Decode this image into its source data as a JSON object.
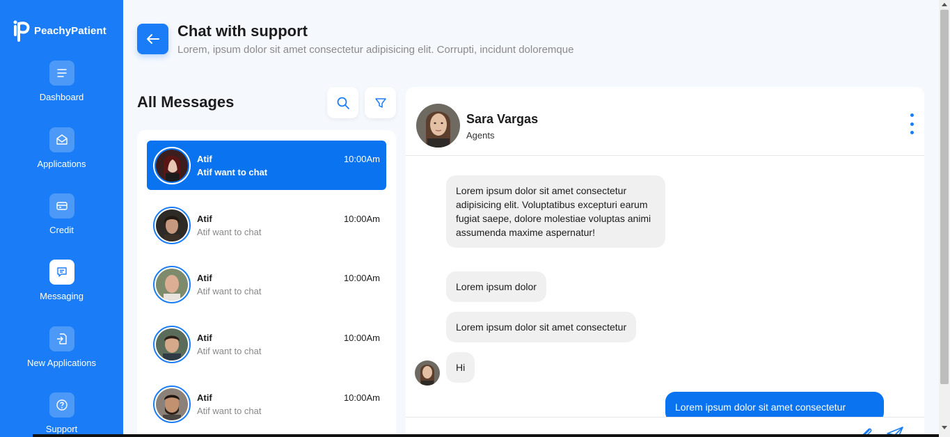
{
  "app": {
    "brand": "PeachyPatient"
  },
  "sidebar": {
    "items": [
      {
        "label": "Dashboard",
        "icon": "menu-icon",
        "active": false
      },
      {
        "label": "Applications",
        "icon": "envelope-icon",
        "active": false
      },
      {
        "label": "Credit",
        "icon": "card-icon",
        "active": false
      },
      {
        "label": "Messaging",
        "icon": "chat-icon",
        "active": true
      },
      {
        "label": "New Applications",
        "icon": "file-import-icon",
        "active": false
      },
      {
        "label": "Support",
        "icon": "help-icon",
        "active": false
      }
    ]
  },
  "header": {
    "title": "Chat with support",
    "subtitle": "Lorem, ipsum dolor sit amet consectetur adipisicing elit. Corrupti, incidunt doloremque"
  },
  "list": {
    "title": "All Messages",
    "conversations": [
      {
        "name": "Atif",
        "message": "Atif want to chat",
        "time": "10:00Am",
        "active": true
      },
      {
        "name": "Atif",
        "message": "Atif want to chat",
        "time": "10:00Am",
        "active": false
      },
      {
        "name": "Atif",
        "message": "Atif want to chat",
        "time": "10:00Am",
        "active": false
      },
      {
        "name": "Atif",
        "message": "Atif want to chat",
        "time": "10:00Am",
        "active": false
      },
      {
        "name": "Atif",
        "message": "Atif want to chat",
        "time": "10:00Am",
        "active": false
      }
    ]
  },
  "chat": {
    "name": "Sara Vargas",
    "role": "Agents",
    "messages": [
      {
        "text": "Lorem ipsum dolor sit amet consectetur adipisicing elit. Voluptatibus excepturi earum fugiat saepe, dolore molestiae voluptas animi assumenda maxime aspernatur!",
        "from": "agent"
      },
      {
        "text": "Lorem ipsum dolor",
        "from": "agent"
      },
      {
        "text": "Lorem ipsum dolor sit amet consectetur",
        "from": "agent"
      },
      {
        "text": "Hi",
        "from": "agent"
      },
      {
        "text": "Lorem ipsum dolor sit amet consectetur",
        "from": "me"
      }
    ],
    "input_placeholder": ""
  },
  "colors": {
    "primary": "#1a7df7",
    "active_item": "#0a73f0",
    "bubble": "#f0f0f0",
    "background": "#f5f8fd"
  }
}
